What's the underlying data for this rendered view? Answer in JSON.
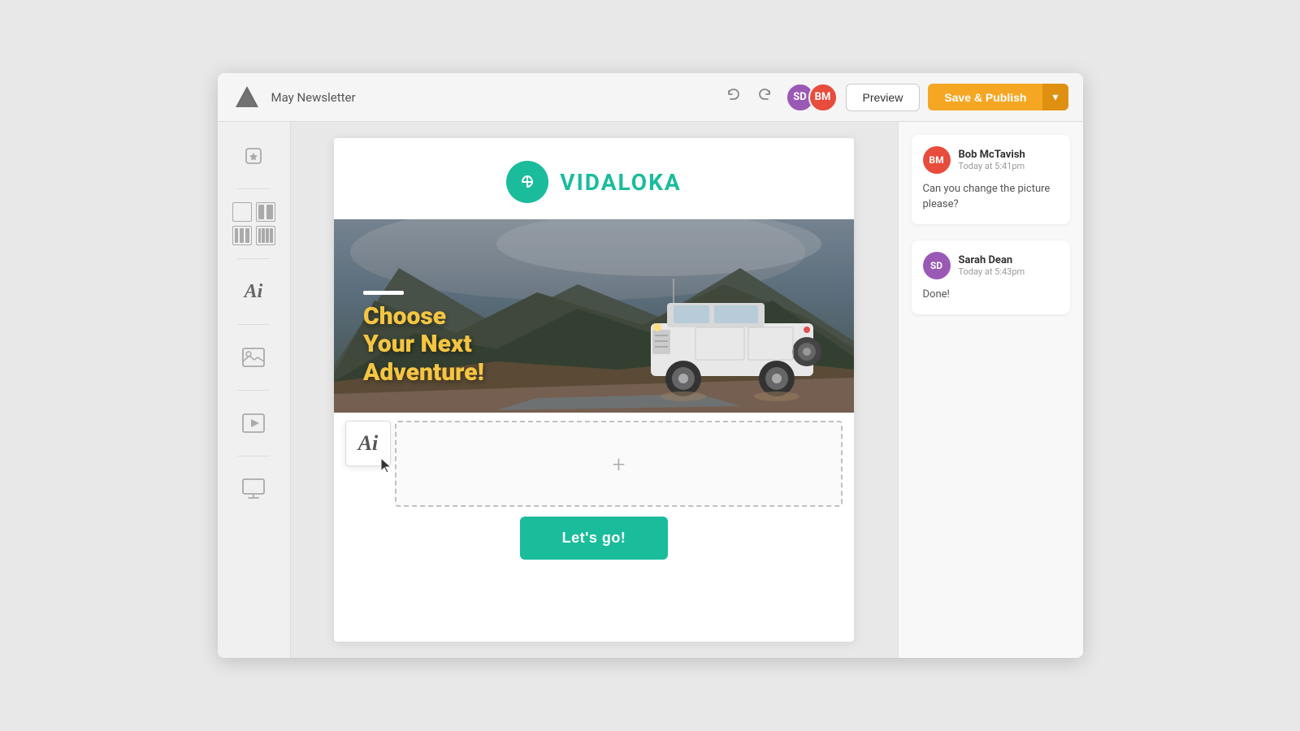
{
  "header": {
    "title": "May Newsletter",
    "undo_label": "↩",
    "redo_label": "↪",
    "preview_label": "Preview",
    "save_publish_label": "Save & Publish",
    "avatar_sd_initials": "SD",
    "avatar_bm_initials": "BM"
  },
  "sidebar": {
    "favorites_icon": "♡",
    "text_icon": "Ai",
    "image_icon": "⛰",
    "video_icon": "▶",
    "screen_icon": "🖥"
  },
  "email": {
    "brand_name": "VIDALOKA",
    "hero_headline": "Choose\nYour Next\nAdventure!",
    "cta_label": "Let's go!",
    "drop_zone_plus": "+"
  },
  "comments": [
    {
      "avatar_initials": "BM",
      "author": "Bob McTavish",
      "time": "Today at 5:41pm",
      "text": "Can you change the picture please?"
    },
    {
      "avatar_initials": "SD",
      "author": "Sarah Dean",
      "time": "Today at 5:43pm",
      "text": "Done!"
    }
  ],
  "floating_text": {
    "label": "Ai"
  }
}
